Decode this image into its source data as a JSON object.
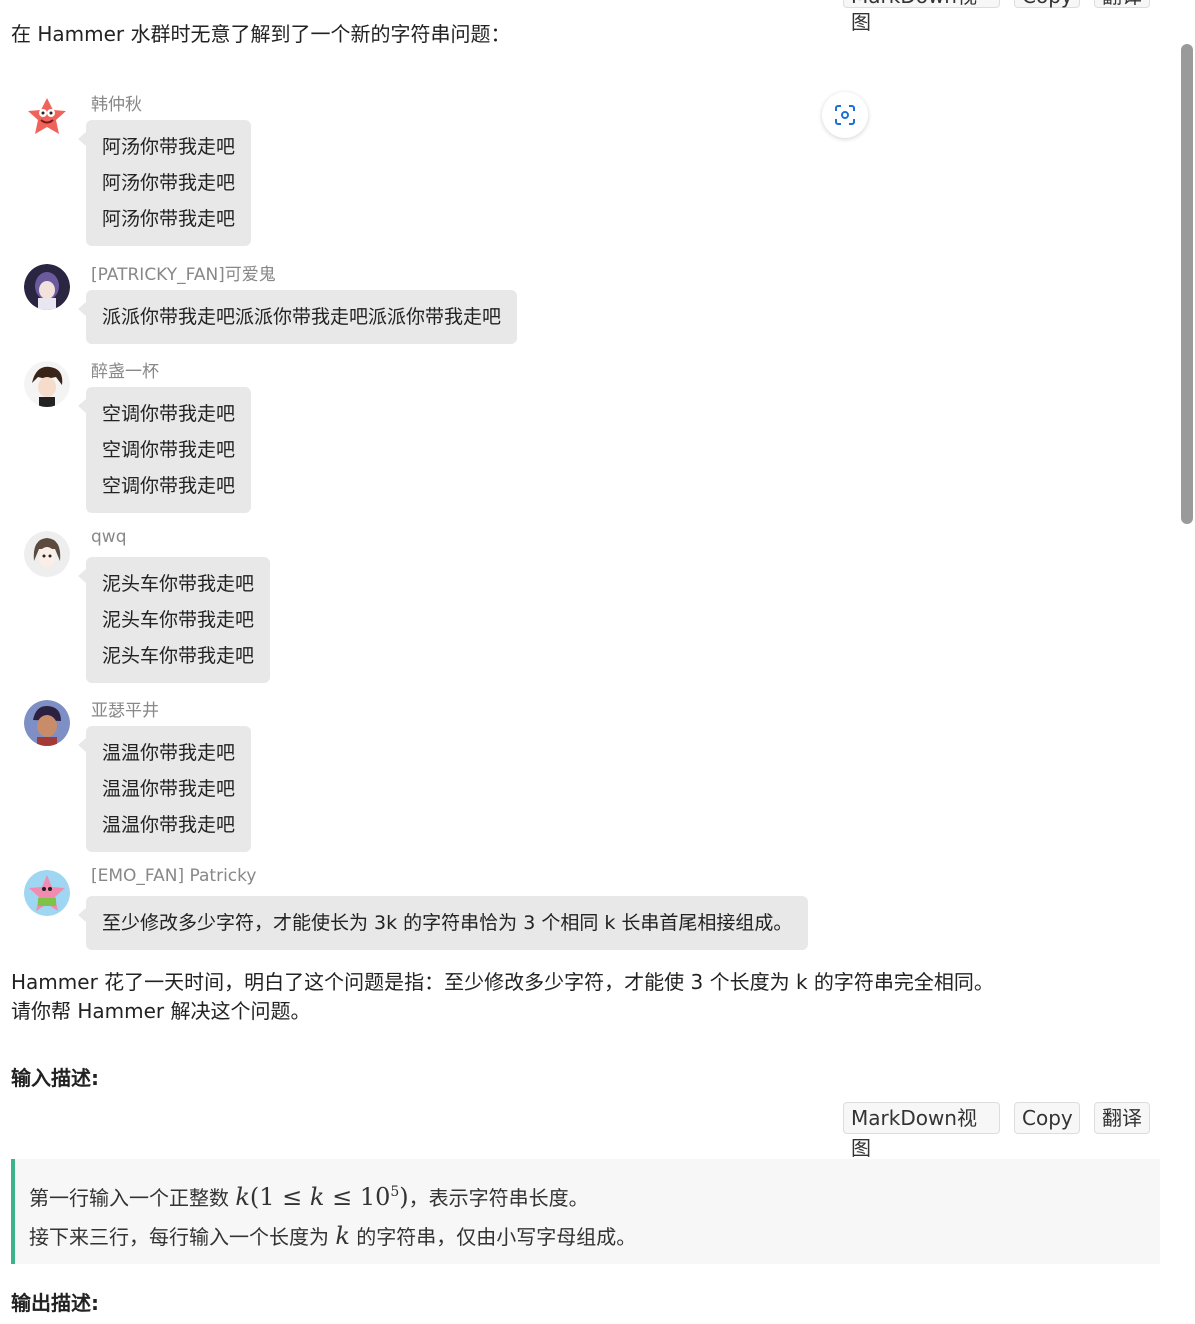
{
  "top_toolbar": {
    "view": "MarkDown视图",
    "copy": "Copy",
    "translate": "翻译"
  },
  "intro": "在 Hammer 水群时无意了解到了一个新的字符串问题：",
  "chat": [
    {
      "name": "韩仲秋",
      "avatar": "patrick-star-avatar",
      "lines": [
        "阿汤你带我走吧",
        "阿汤你带我走吧",
        "阿汤你带我走吧"
      ]
    },
    {
      "name": "[PATRICKY_FAN]可爱鬼",
      "avatar": "anime-girl-avatar",
      "lines": [
        "派派你带我走吧派派你带我走吧派派你带我走吧"
      ]
    },
    {
      "name": "醉盏一杯",
      "avatar": "anime-boy-avatar",
      "lines": [
        "空调你带我走吧",
        "空调你带我走吧",
        "空调你带我走吧"
      ]
    },
    {
      "name": "qwq",
      "avatar": "anime-girl-sketch-avatar",
      "lines": [
        "泥头车你带我走吧",
        "泥头车你带我走吧",
        "泥头车你带我走吧"
      ]
    },
    {
      "name": "亚瑟平井",
      "avatar": "anime-man-avatar",
      "lines": [
        "温温你带我走吧",
        "温温你带我走吧",
        "温温你带我走吧"
      ]
    },
    {
      "name": "[EMO_FAN] Patricky",
      "avatar": "patrick-star-avatar-2",
      "lines": [
        "至少修改多少字符，才能使长为 3k 的字符串恰为 3 个相同 k 长串首尾相接组成。"
      ]
    }
  ],
  "explain": [
    "Hammer 花了一天时间，明白了这个问题是指：至少修改多少字符，才能使 3 个长度为 k 的字符串完全相同。",
    "请你帮 Hammer 解决这个问题。"
  ],
  "input_heading": "输入描述:",
  "input_toolbar": {
    "view": "MarkDown视图",
    "copy": "Copy",
    "translate": "翻译"
  },
  "input_desc": {
    "line1_pre": "第一行输入一个正整数 ",
    "line1_var": "k",
    "line1_math_open": "(1 ≤ ",
    "line1_math_var": "k",
    "line1_math_mid": " ≤ 10",
    "line1_math_sup": "5",
    "line1_math_close": ")",
    "line1_post": "，表示字符串长度。",
    "line2_pre": "接下来三行，每行输入一个长度为 ",
    "line2_var": "k",
    "line2_post": " 的字符串，仅由小写字母组成。"
  },
  "output_heading": "输出描述:"
}
